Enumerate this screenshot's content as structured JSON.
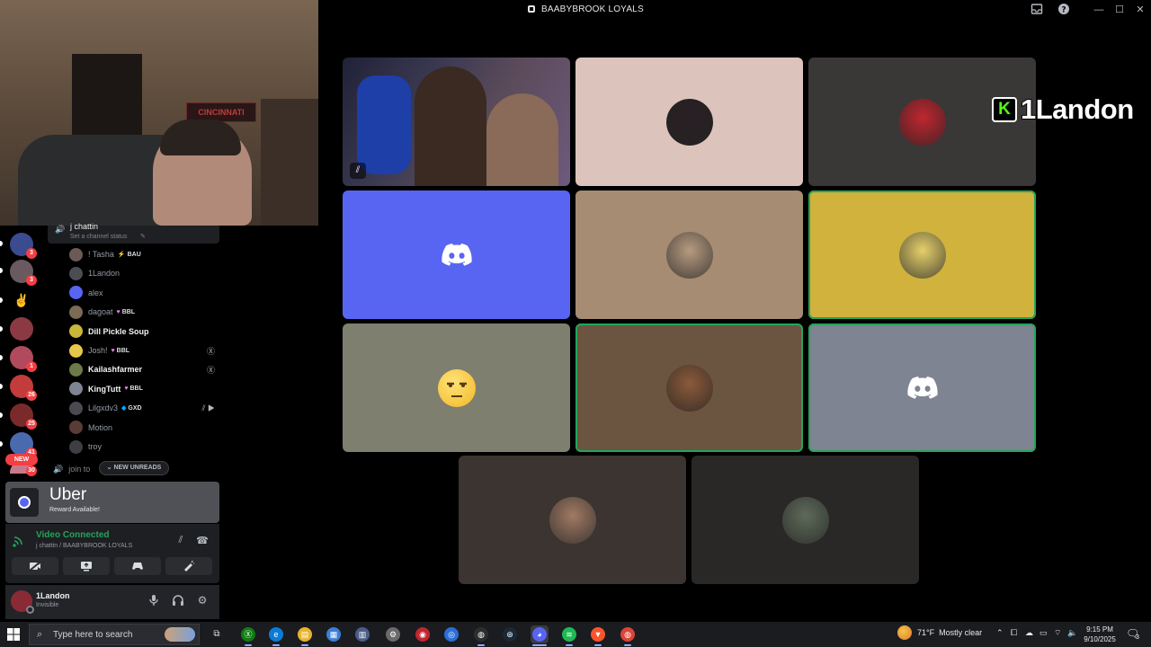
{
  "window": {
    "title": "BAABYBROOK LOYALS",
    "controls": [
      "inbox-icon",
      "help-icon",
      "minimize",
      "maximize",
      "close"
    ]
  },
  "webcam": {
    "banner_text": "CINCINNATI"
  },
  "server_rail": {
    "items": [
      {
        "badge": "3"
      },
      {
        "badge": "3"
      },
      {
        "badge": ""
      },
      {
        "badge": ""
      },
      {
        "badge": "1"
      },
      {
        "badge": "26"
      },
      {
        "badge": "25"
      },
      {
        "badge": "41"
      },
      {
        "badge": "30"
      }
    ],
    "new_label": "NEW"
  },
  "voice_channel": {
    "name": "j chattin",
    "status_placeholder": "Set a channel status",
    "members": [
      {
        "name": "! Tasha",
        "tag": "BAU",
        "tag_icon": "lightning-icon",
        "active": false,
        "avatar_color": "#6b5a58"
      },
      {
        "name": "1Landon",
        "tag": "",
        "active": false,
        "avatar_color": "#4a4d52"
      },
      {
        "name": "alex",
        "tag": "",
        "active": false,
        "avatar_color": "#5865f2"
      },
      {
        "name": "dagoat",
        "tag": "BBL",
        "tag_icon": "heart-icon",
        "active": false,
        "avatar_color": "#7b6a55"
      },
      {
        "name": "Dill Pickle Soup",
        "tag": "",
        "active": true,
        "avatar_color": "#c9b838"
      },
      {
        "name": "Josh!",
        "tag": "BBL",
        "tag_icon": "heart-icon",
        "active": false,
        "avatar_color": "#e8c84a",
        "right_icon": "xbox-icon"
      },
      {
        "name": "Kailashfarmer",
        "tag": "",
        "active": true,
        "avatar_color": "#6c7a4a",
        "right_icon": "xbox-icon"
      },
      {
        "name": "KingTutt",
        "tag": "BBL",
        "tag_icon": "heart-icon",
        "active": true,
        "avatar_color": "#7e8491"
      },
      {
        "name": "Lilgxdv3",
        "tag": "GXD",
        "tag_icon": "diamond-icon",
        "active": false,
        "avatar_color": "#4a4a50",
        "right_icon": "muted-video-icons"
      },
      {
        "name": "Motion",
        "tag": "",
        "active": false,
        "avatar_color": "#5a3c36"
      },
      {
        "name": "troy",
        "tag": "",
        "active": false,
        "avatar_color": "#3d3f44"
      }
    ],
    "next_channel": "join to",
    "new_unreads": "NEW UNREADS"
  },
  "promo": {
    "brand": "Uber",
    "subtitle": "Reward Available!"
  },
  "voice_panel": {
    "status": "Video Connected",
    "location": "j chattin / BAABYBROOK LOYALS"
  },
  "user_panel": {
    "username": "1Landon",
    "status": "Invisible"
  },
  "overlay_badge": {
    "letter": "K",
    "name": "1Landon"
  },
  "video_grid": {
    "tiles": [
      {
        "kind": "video",
        "bg": "#3b3a4a",
        "muted": true
      },
      {
        "kind": "avatar",
        "bg": "#dcc3bb",
        "avatar_color": "#2a2024"
      },
      {
        "kind": "avatar",
        "bg": "#3a3837",
        "avatar_color": "#c0262f"
      },
      {
        "kind": "discord",
        "bg": "#5865f2"
      },
      {
        "kind": "avatar",
        "bg": "#a58c72",
        "avatar_color": "#b79b80"
      },
      {
        "kind": "avatar",
        "bg": "#d0b23c",
        "avatar_color": "#e6d06a",
        "speaking": true
      },
      {
        "kind": "emoji",
        "bg": "#7e7f6e"
      },
      {
        "kind": "avatar",
        "bg": "#6b5540",
        "avatar_color": "#8b5a3a",
        "speaking": true
      },
      {
        "kind": "discord",
        "bg": "#7e8491",
        "speaking": true
      },
      {
        "kind": "avatar",
        "bg": "#3b3430",
        "avatar_color": "#a07a64"
      },
      {
        "kind": "avatar",
        "bg": "#2a2826",
        "avatar_color": "#5e6a5a"
      }
    ]
  },
  "taskbar": {
    "search_placeholder": "Type here to search",
    "apps": [
      "xbox",
      "edge",
      "file-explorer",
      "store",
      "calculator",
      "settings",
      "app-red",
      "app-blue",
      "app-dark",
      "steam",
      "discord",
      "spotify",
      "brave",
      "chrome"
    ],
    "weather": "71°F  Mostly clear",
    "time": "9:15 PM",
    "date": "9/10/2025",
    "notifications": "3"
  }
}
